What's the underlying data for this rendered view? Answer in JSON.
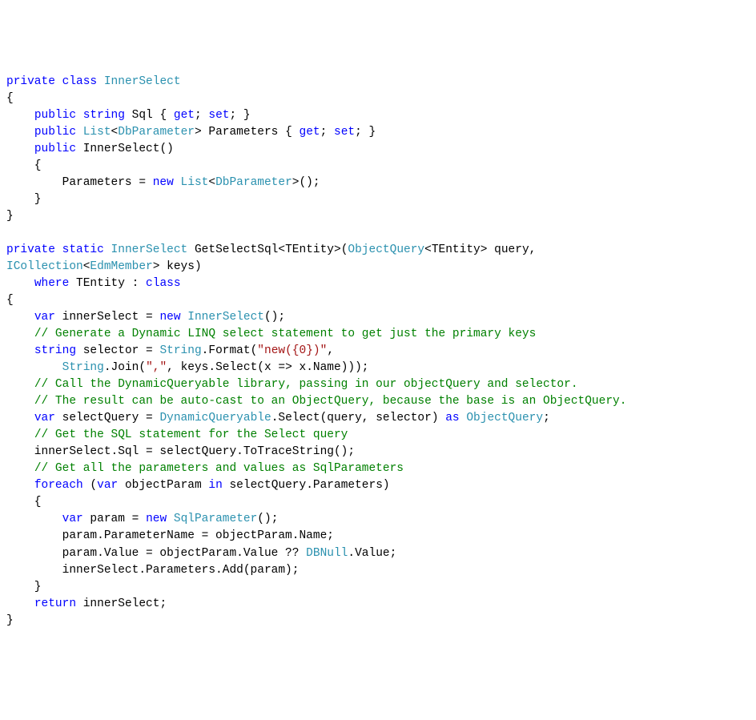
{
  "code": {
    "lines": [
      [
        {
          "cls": "kw",
          "txt": "private"
        },
        {
          "cls": "pln",
          "txt": " "
        },
        {
          "cls": "kw",
          "txt": "class"
        },
        {
          "cls": "pln",
          "txt": " "
        },
        {
          "cls": "typ",
          "txt": "InnerSelect"
        }
      ],
      [
        {
          "cls": "pln",
          "txt": "{"
        }
      ],
      [
        {
          "cls": "pln",
          "txt": "    "
        },
        {
          "cls": "kw",
          "txt": "public"
        },
        {
          "cls": "pln",
          "txt": " "
        },
        {
          "cls": "kw",
          "txt": "string"
        },
        {
          "cls": "pln",
          "txt": " Sql { "
        },
        {
          "cls": "kw",
          "txt": "get"
        },
        {
          "cls": "pln",
          "txt": "; "
        },
        {
          "cls": "kw",
          "txt": "set"
        },
        {
          "cls": "pln",
          "txt": "; }"
        }
      ],
      [
        {
          "cls": "pln",
          "txt": "    "
        },
        {
          "cls": "kw",
          "txt": "public"
        },
        {
          "cls": "pln",
          "txt": " "
        },
        {
          "cls": "typ",
          "txt": "List"
        },
        {
          "cls": "pln",
          "txt": "<"
        },
        {
          "cls": "typ",
          "txt": "DbParameter"
        },
        {
          "cls": "pln",
          "txt": "> Parameters { "
        },
        {
          "cls": "kw",
          "txt": "get"
        },
        {
          "cls": "pln",
          "txt": "; "
        },
        {
          "cls": "kw",
          "txt": "set"
        },
        {
          "cls": "pln",
          "txt": "; }"
        }
      ],
      [
        {
          "cls": "pln",
          "txt": "    "
        },
        {
          "cls": "kw",
          "txt": "public"
        },
        {
          "cls": "pln",
          "txt": " InnerSelect()"
        }
      ],
      [
        {
          "cls": "pln",
          "txt": "    {"
        }
      ],
      [
        {
          "cls": "pln",
          "txt": "        Parameters = "
        },
        {
          "cls": "kw",
          "txt": "new"
        },
        {
          "cls": "pln",
          "txt": " "
        },
        {
          "cls": "typ",
          "txt": "List"
        },
        {
          "cls": "pln",
          "txt": "<"
        },
        {
          "cls": "typ",
          "txt": "DbParameter"
        },
        {
          "cls": "pln",
          "txt": ">();"
        }
      ],
      [
        {
          "cls": "pln",
          "txt": "    }"
        }
      ],
      [
        {
          "cls": "pln",
          "txt": "}"
        }
      ],
      [
        {
          "cls": "pln",
          "txt": ""
        }
      ],
      [
        {
          "cls": "kw",
          "txt": "private"
        },
        {
          "cls": "pln",
          "txt": " "
        },
        {
          "cls": "kw",
          "txt": "static"
        },
        {
          "cls": "pln",
          "txt": " "
        },
        {
          "cls": "typ",
          "txt": "InnerSelect"
        },
        {
          "cls": "pln",
          "txt": " GetSelectSql<TEntity>("
        },
        {
          "cls": "typ",
          "txt": "ObjectQuery"
        },
        {
          "cls": "pln",
          "txt": "<TEntity> query,"
        }
      ],
      [
        {
          "cls": "typ",
          "txt": "ICollection"
        },
        {
          "cls": "pln",
          "txt": "<"
        },
        {
          "cls": "typ",
          "txt": "EdmMember"
        },
        {
          "cls": "pln",
          "txt": "> keys)"
        }
      ],
      [
        {
          "cls": "pln",
          "txt": "    "
        },
        {
          "cls": "kw",
          "txt": "where"
        },
        {
          "cls": "pln",
          "txt": " TEntity : "
        },
        {
          "cls": "kw",
          "txt": "class"
        }
      ],
      [
        {
          "cls": "pln",
          "txt": "{"
        }
      ],
      [
        {
          "cls": "pln",
          "txt": "    "
        },
        {
          "cls": "kw",
          "txt": "var"
        },
        {
          "cls": "pln",
          "txt": " innerSelect = "
        },
        {
          "cls": "kw",
          "txt": "new"
        },
        {
          "cls": "pln",
          "txt": " "
        },
        {
          "cls": "typ",
          "txt": "InnerSelect"
        },
        {
          "cls": "pln",
          "txt": "();"
        }
      ],
      [
        {
          "cls": "pln",
          "txt": "    "
        },
        {
          "cls": "com",
          "txt": "// Generate a Dynamic LINQ select statement to get just the primary keys"
        }
      ],
      [
        {
          "cls": "pln",
          "txt": "    "
        },
        {
          "cls": "kw",
          "txt": "string"
        },
        {
          "cls": "pln",
          "txt": " selector = "
        },
        {
          "cls": "typ",
          "txt": "String"
        },
        {
          "cls": "pln",
          "txt": ".Format("
        },
        {
          "cls": "str",
          "txt": "\"new({0})\""
        },
        {
          "cls": "pln",
          "txt": ","
        }
      ],
      [
        {
          "cls": "pln",
          "txt": "        "
        },
        {
          "cls": "typ",
          "txt": "String"
        },
        {
          "cls": "pln",
          "txt": ".Join("
        },
        {
          "cls": "str",
          "txt": "\",\""
        },
        {
          "cls": "pln",
          "txt": ", keys.Select(x => x.Name)));"
        }
      ],
      [
        {
          "cls": "pln",
          "txt": "    "
        },
        {
          "cls": "com",
          "txt": "// Call the DynamicQueryable library, passing in our objectQuery and selector."
        }
      ],
      [
        {
          "cls": "pln",
          "txt": "    "
        },
        {
          "cls": "com",
          "txt": "// The result can be auto-cast to an ObjectQuery, because the base is an ObjectQuery."
        }
      ],
      [
        {
          "cls": "pln",
          "txt": "    "
        },
        {
          "cls": "kw",
          "txt": "var"
        },
        {
          "cls": "pln",
          "txt": " selectQuery = "
        },
        {
          "cls": "typ",
          "txt": "DynamicQueryable"
        },
        {
          "cls": "pln",
          "txt": ".Select(query, selector) "
        },
        {
          "cls": "kw",
          "txt": "as"
        },
        {
          "cls": "pln",
          "txt": " "
        },
        {
          "cls": "typ",
          "txt": "ObjectQuery"
        },
        {
          "cls": "pln",
          "txt": ";"
        }
      ],
      [
        {
          "cls": "pln",
          "txt": "    "
        },
        {
          "cls": "com",
          "txt": "// Get the SQL statement for the Select query"
        }
      ],
      [
        {
          "cls": "pln",
          "txt": "    innerSelect.Sql = selectQuery.ToTraceString();"
        }
      ],
      [
        {
          "cls": "pln",
          "txt": "    "
        },
        {
          "cls": "com",
          "txt": "// Get all the parameters and values as SqlParameters"
        }
      ],
      [
        {
          "cls": "pln",
          "txt": "    "
        },
        {
          "cls": "kw",
          "txt": "foreach"
        },
        {
          "cls": "pln",
          "txt": " ("
        },
        {
          "cls": "kw",
          "txt": "var"
        },
        {
          "cls": "pln",
          "txt": " objectParam "
        },
        {
          "cls": "kw",
          "txt": "in"
        },
        {
          "cls": "pln",
          "txt": " selectQuery.Parameters)"
        }
      ],
      [
        {
          "cls": "pln",
          "txt": "    {"
        }
      ],
      [
        {
          "cls": "pln",
          "txt": "        "
        },
        {
          "cls": "kw",
          "txt": "var"
        },
        {
          "cls": "pln",
          "txt": " param = "
        },
        {
          "cls": "kw",
          "txt": "new"
        },
        {
          "cls": "pln",
          "txt": " "
        },
        {
          "cls": "typ",
          "txt": "SqlParameter"
        },
        {
          "cls": "pln",
          "txt": "();"
        }
      ],
      [
        {
          "cls": "pln",
          "txt": "        param.ParameterName = objectParam.Name;"
        }
      ],
      [
        {
          "cls": "pln",
          "txt": "        param.Value = objectParam.Value ?? "
        },
        {
          "cls": "typ",
          "txt": "DBNull"
        },
        {
          "cls": "pln",
          "txt": ".Value;"
        }
      ],
      [
        {
          "cls": "pln",
          "txt": "        innerSelect.Parameters.Add(param);"
        }
      ],
      [
        {
          "cls": "pln",
          "txt": "    }"
        }
      ],
      [
        {
          "cls": "pln",
          "txt": "    "
        },
        {
          "cls": "kw",
          "txt": "return"
        },
        {
          "cls": "pln",
          "txt": " innerSelect;"
        }
      ],
      [
        {
          "cls": "pln",
          "txt": "}"
        }
      ]
    ]
  }
}
